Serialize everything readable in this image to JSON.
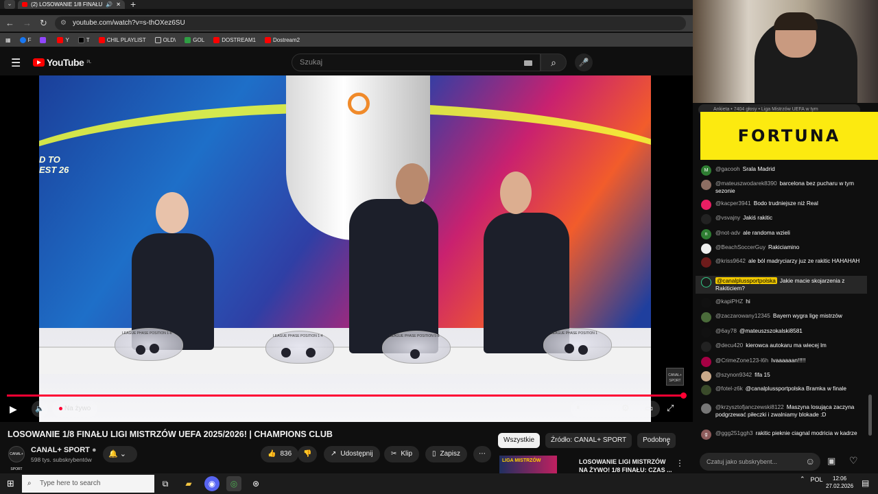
{
  "browser": {
    "tab_title": "(2) LOSOWANIE 1/8 FINAŁU",
    "tab_audio_icon": "speaker-icon",
    "new_tab": "+",
    "url": "youtube.com/watch?v=s-thOXez6SU",
    "bookmarks": [
      {
        "label": "F",
        "color": "#1877f2"
      },
      {
        "label": "",
        "color": "#9146ff"
      },
      {
        "label": "Y",
        "color": "#ff0000"
      },
      {
        "label": "T",
        "color": "#000000"
      },
      {
        "label": "CHIL PLAYLIST",
        "color": "#ff0000"
      },
      {
        "label": "OLD\\",
        "color": "#888888"
      },
      {
        "label": "GOL",
        "color": "#2f9e44"
      },
      {
        "label": "DOSTREAM1",
        "color": "#ff0000"
      },
      {
        "label": "Dostream2",
        "color": "#ff0000"
      }
    ]
  },
  "youtube": {
    "logo_text": "YouTube",
    "logo_region": "PL",
    "search_placeholder": "Szukaj"
  },
  "player": {
    "live_label": "Na żywo",
    "overlay_left_text_1": "D TO",
    "overlay_left_text_2": "EST 26",
    "bowls": [
      "LEAGUE PHASE POSITION 1-8",
      "LEAGUE PHASE POSITION 1-4",
      "LEAGUE PHASE POSITION 5-8",
      "LEAGUE PHASE POSITION 1"
    ],
    "channel_watermark": "CANAL+ SPORT",
    "progress": 1.0
  },
  "video": {
    "title": "LOSOWANIE 1/8 FINAŁU LIGI MISTRZÓW UEFA 2025/2026! | CHAMPIONS CLUB",
    "channel_name": "CANAL+ SPORT",
    "channel_avatar_text": "CANAL+ SPORT",
    "subscribers": "598 tys. subskrybentów",
    "likes": "836",
    "share_label": "Udostępnij",
    "clip_label": "Klip",
    "save_label": "Zapisz"
  },
  "filters": {
    "chips": [
      "Wszystkie",
      "Źródło: CANAL+ SPORT",
      "Podobne"
    ]
  },
  "recommendation": {
    "thumb_text": "LIGA MISTRZÓW",
    "title": "LOSOWANIE LIGI MISTRZÓW NA ŻYWO! 1/8 FINAŁU: CZAS ..."
  },
  "chat": {
    "pinned_preview": "Ankieta • 7404 głosy • Liga Mistrzów UEFA w tym",
    "sponsor": "FORTUNA",
    "messages": [
      {
        "author": "@gacooh",
        "text": "Srala Madrid",
        "avatar": "M",
        "color": "#2e7d32"
      },
      {
        "author": "@mateuszwodarek8390",
        "text": "barcelona bez pucharu w tym sezonie",
        "avatar": "",
        "color": "#8d6e63"
      },
      {
        "author": "@kacper3941",
        "text": "Bodo trudniejsze niż Real",
        "avatar": "",
        "color": "#e91e63"
      },
      {
        "author": "@vsvajny",
        "text": "Jakiś rakitic",
        "avatar": "",
        "color": "#111111"
      },
      {
        "author": "@not-adv",
        "text": "ale randoma wzieli",
        "avatar": "n",
        "color": "#2e7d32"
      },
      {
        "author": "@BeachSoccerGuy",
        "text": "Rakiciamino",
        "avatar": "",
        "color": "#ffffff"
      },
      {
        "author": "@kriss9642",
        "text": "ale ból madryciarzy juz ze rakitic HAHAHAH",
        "avatar": "",
        "color": "#6d1b1b"
      },
      {
        "author": "@canalplussportpolska",
        "text": "Jakie macie skojarzenia z Rakiticiem?",
        "avatar": "",
        "color": "#1b1b1b",
        "moderator": true
      },
      {
        "author": "@kapiPHZ",
        "text": "hi",
        "avatar": "",
        "color": "#111111"
      },
      {
        "author": "@zaczarowany12345",
        "text": "Bayern wygra ligę mistrzów",
        "avatar": "",
        "color": "#4a6b3a"
      },
      {
        "author": "@6ay78",
        "text": "@mateuszszokalski8581",
        "avatar": "",
        "color": "#111111"
      },
      {
        "author": "@decu420",
        "text": "kierowca autokaru ma wiecej lm",
        "avatar": "",
        "color": "#222222"
      },
      {
        "author": "@CrimeZone123-l6h",
        "text": "Ivaaaaaan!!!!!",
        "avatar": "",
        "color": "#a50044"
      },
      {
        "author": "@szynon9342",
        "text": "fifa 15",
        "avatar": "",
        "color": "#c9a98a"
      },
      {
        "author": "@fotel-z6k",
        "text": "@canalplussportpolska Bramka w finale",
        "avatar": "",
        "color": "#3a4a2a"
      },
      {
        "author": "@krzysztofjanczewski8122",
        "text": "Maszyna losująca zaczyna podgrzewać piłeczki i zwalniamy blokade :D",
        "avatar": "",
        "color": "#777777"
      },
      {
        "author": "@ggg251ggh3",
        "text": "rakitic pieknie ciagnal modricia w kadrze",
        "avatar": "g",
        "color": "#8d5b5b"
      }
    ],
    "input_placeholder": "Czatuj jako subskrybent..."
  },
  "taskbar": {
    "search_placeholder": "Type here to search",
    "language": "POL",
    "time": "12:06",
    "date": "27.02.2026"
  }
}
